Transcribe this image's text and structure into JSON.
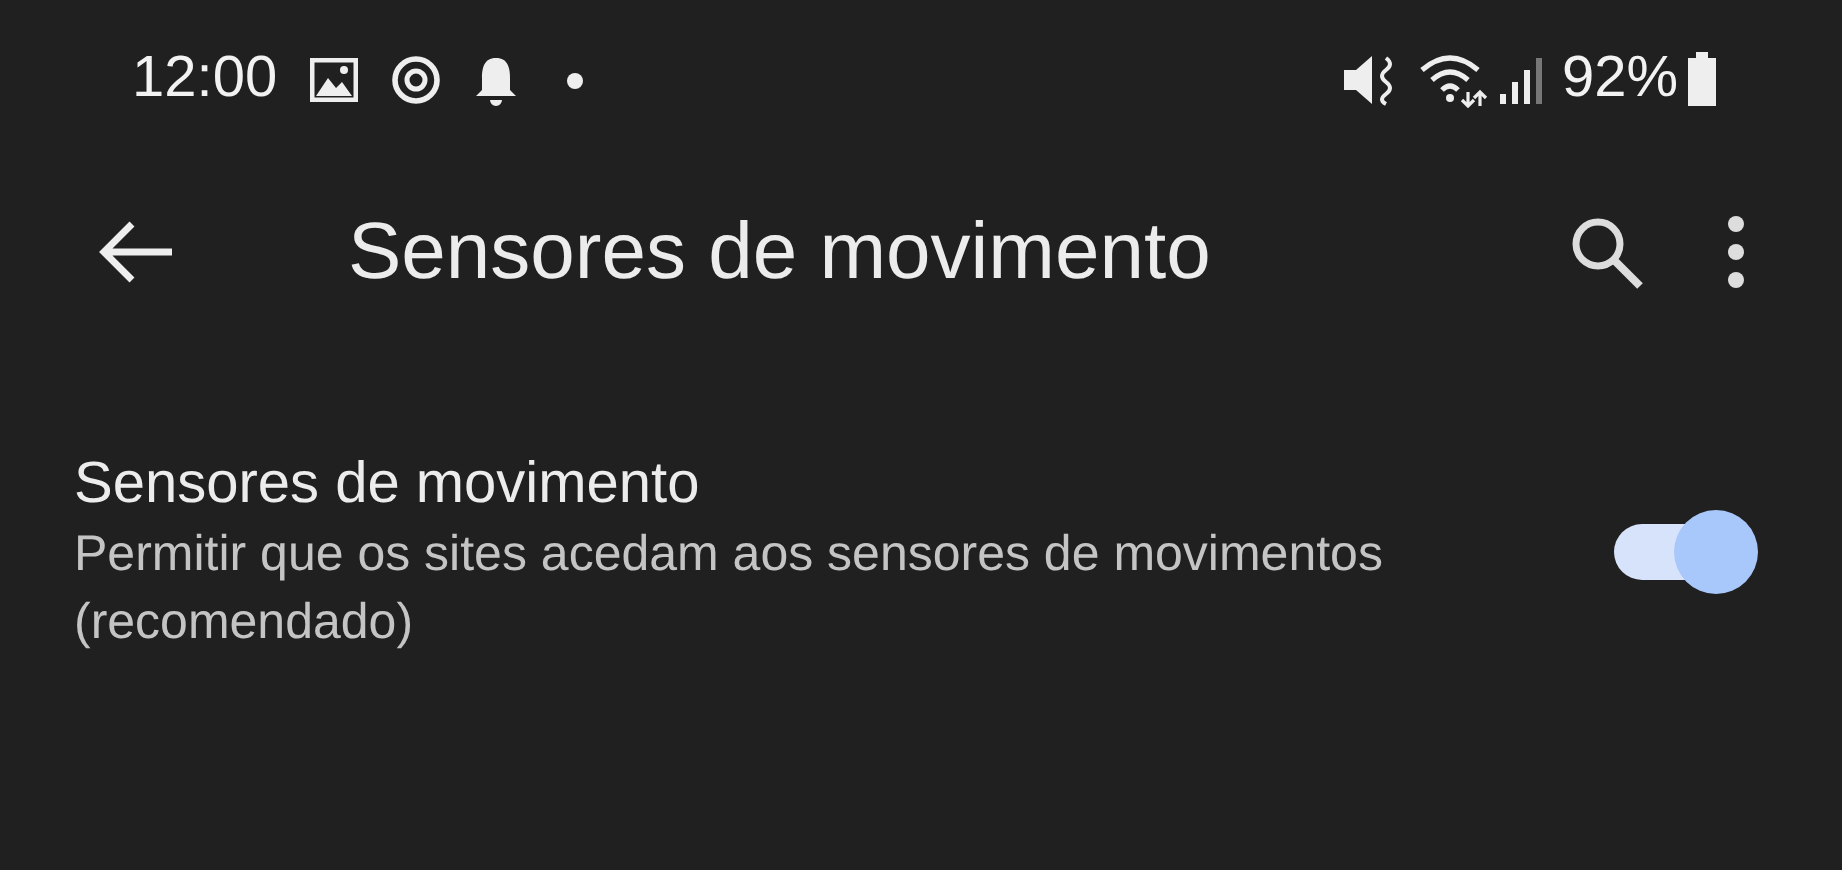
{
  "status_bar": {
    "time": "12:00",
    "battery": "92%"
  },
  "app_bar": {
    "title": "Sensores de movimento"
  },
  "settings": [
    {
      "title": "Sensores de movimento",
      "summary": "Permitir que os sites acedam aos sensores de movimentos (recomendado)",
      "on": true
    }
  ]
}
